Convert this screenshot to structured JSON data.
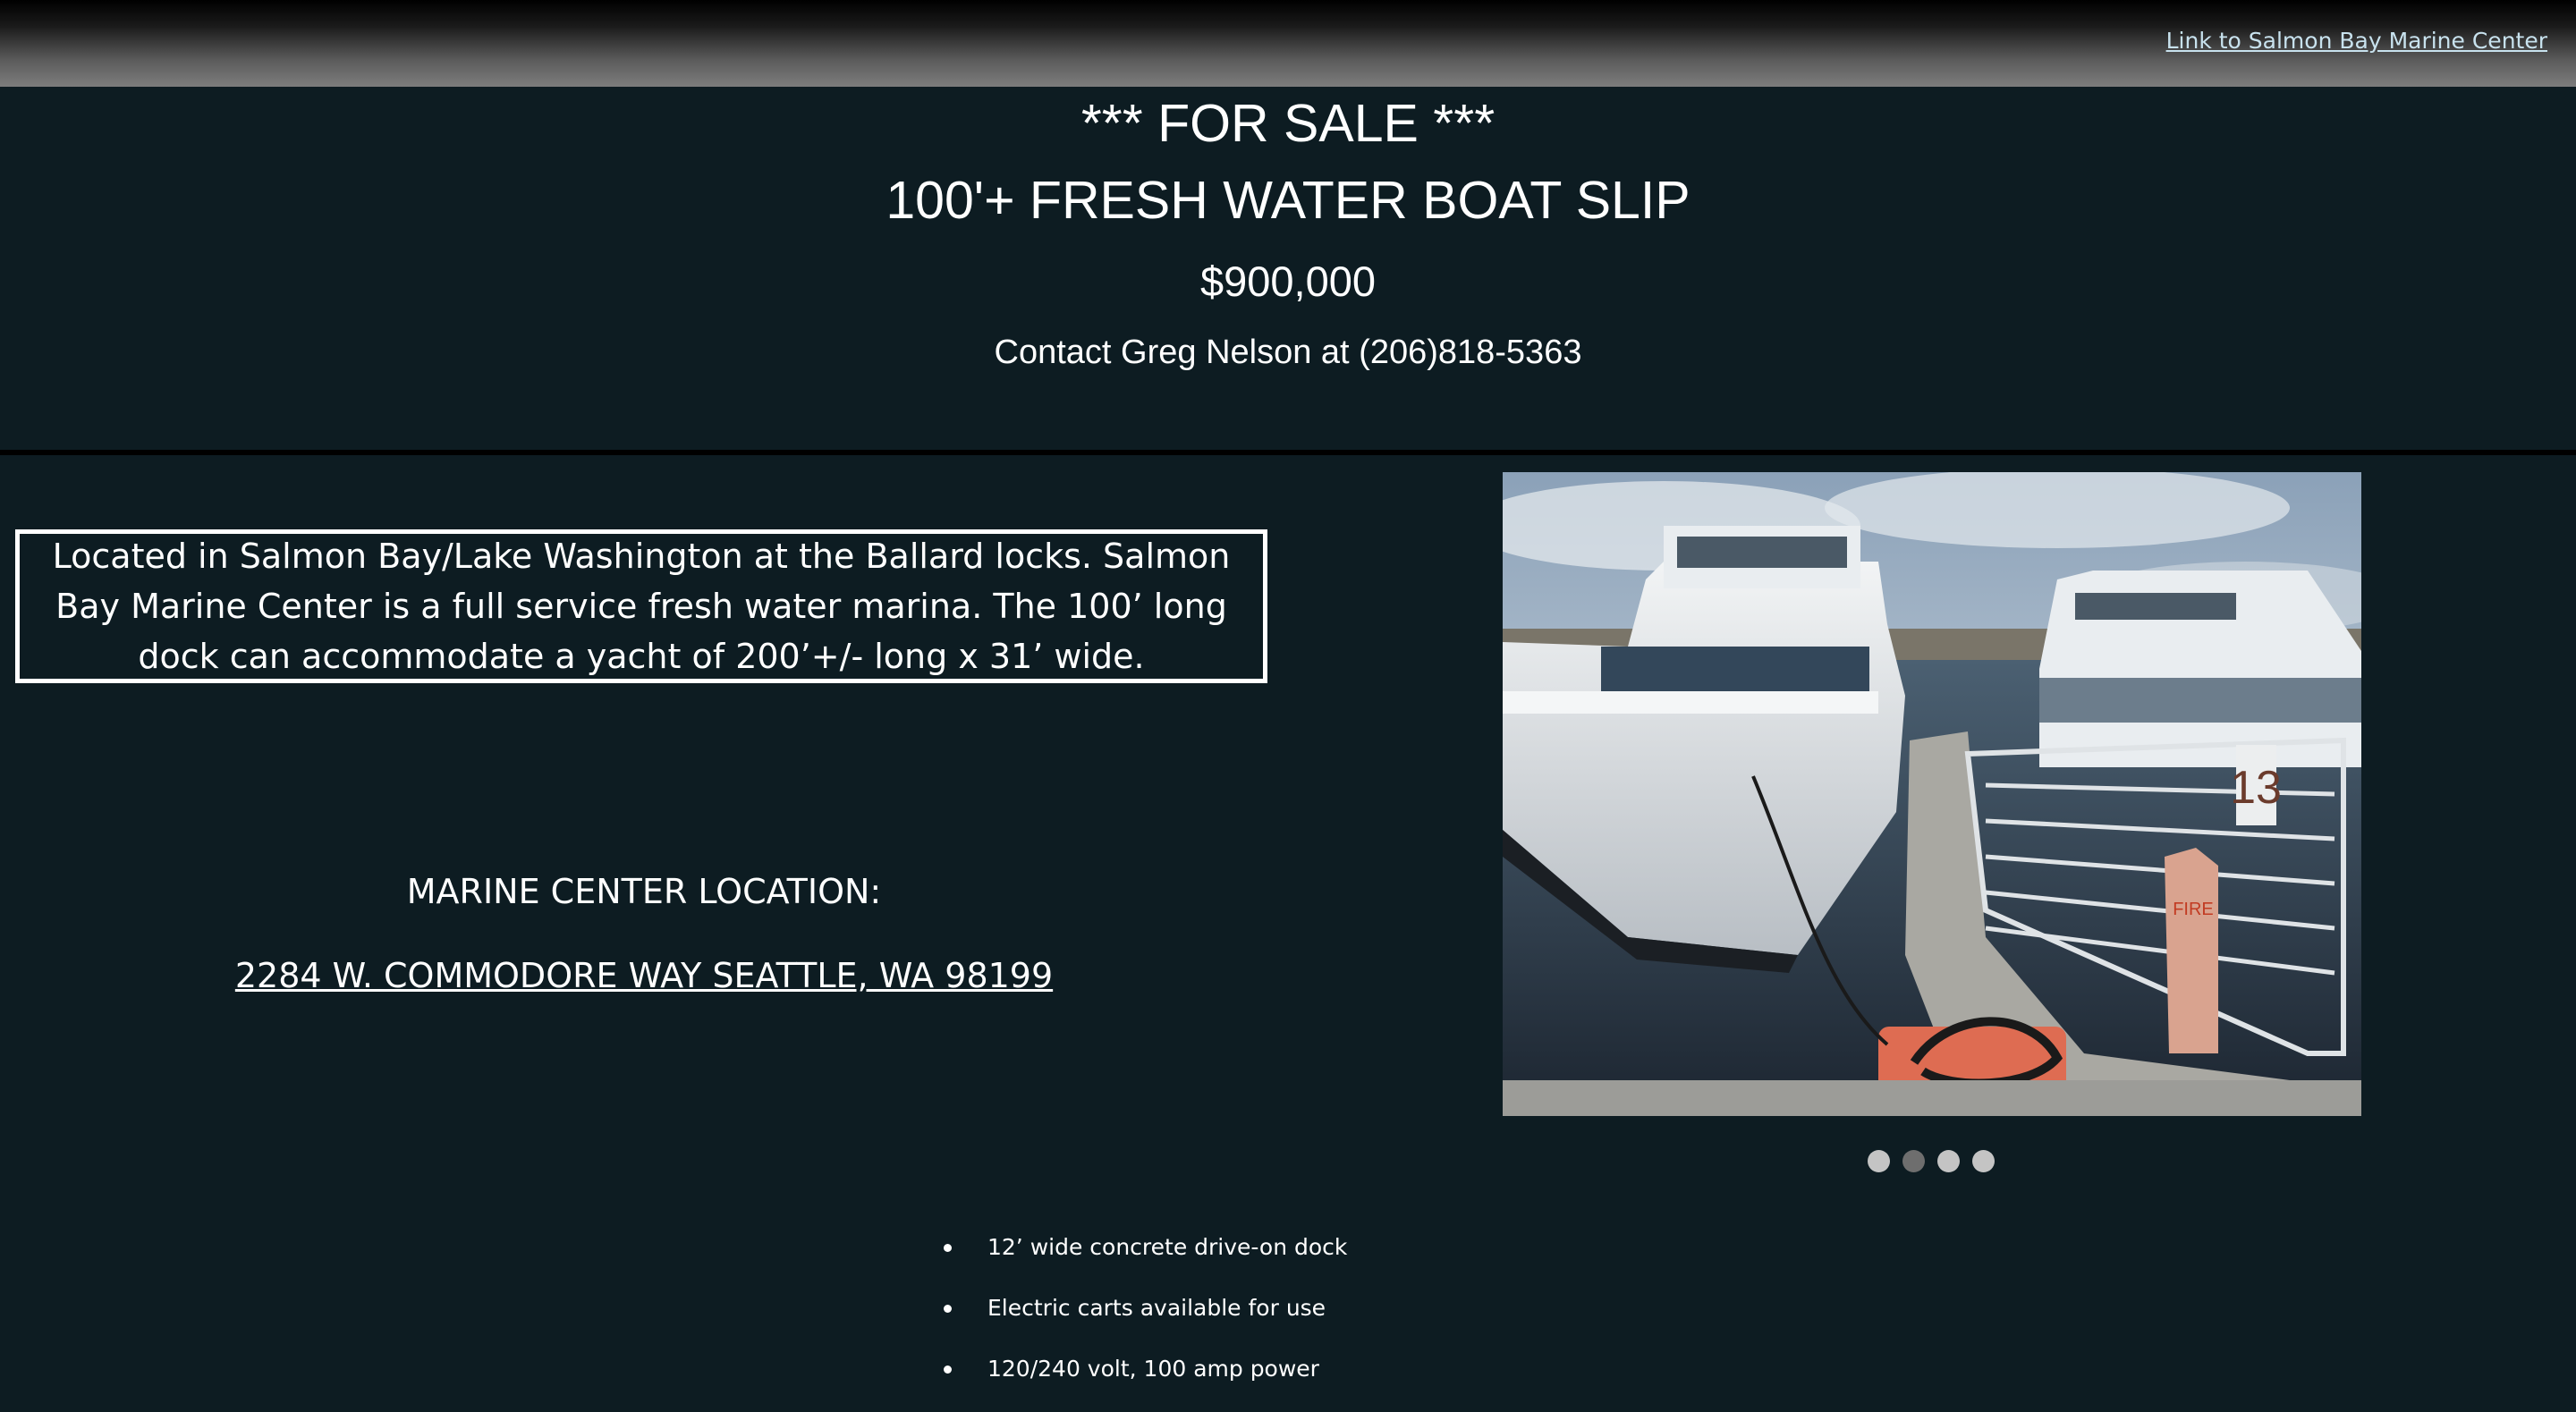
{
  "topbar": {
    "link_text": "Link to Salmon Bay Marine Center"
  },
  "header": {
    "for_sale": "*** FOR SALE ***",
    "title": "100'+ FRESH WATER BOAT SLIP",
    "price": "$900,000",
    "contact": "Contact Greg Nelson at (206)818-5363"
  },
  "description": "Located in Salmon Bay/Lake Washington at the Ballard locks. Salmon Bay Marine Center is a full service fresh water marina. The 100’ long dock can accommodate a yacht of 200’+/- long x 31’ wide.",
  "location": {
    "label": "MARINE CENTER LOCATION:",
    "address": "2284 W. COMMODORE WAY SEATTLE, WA 98199"
  },
  "slideshow": {
    "photo_label": "13",
    "photo_sign": "FIRE",
    "slide_count": 4,
    "active_index": 1
  },
  "features": [
    "12’ wide concrete drive-on dock",
    "Electric carts available for use",
    "120/240 volt, 100 amp power"
  ],
  "colors": {
    "background": "#0d1c22",
    "link": "#c8e2ee",
    "text": "#ffffff"
  }
}
